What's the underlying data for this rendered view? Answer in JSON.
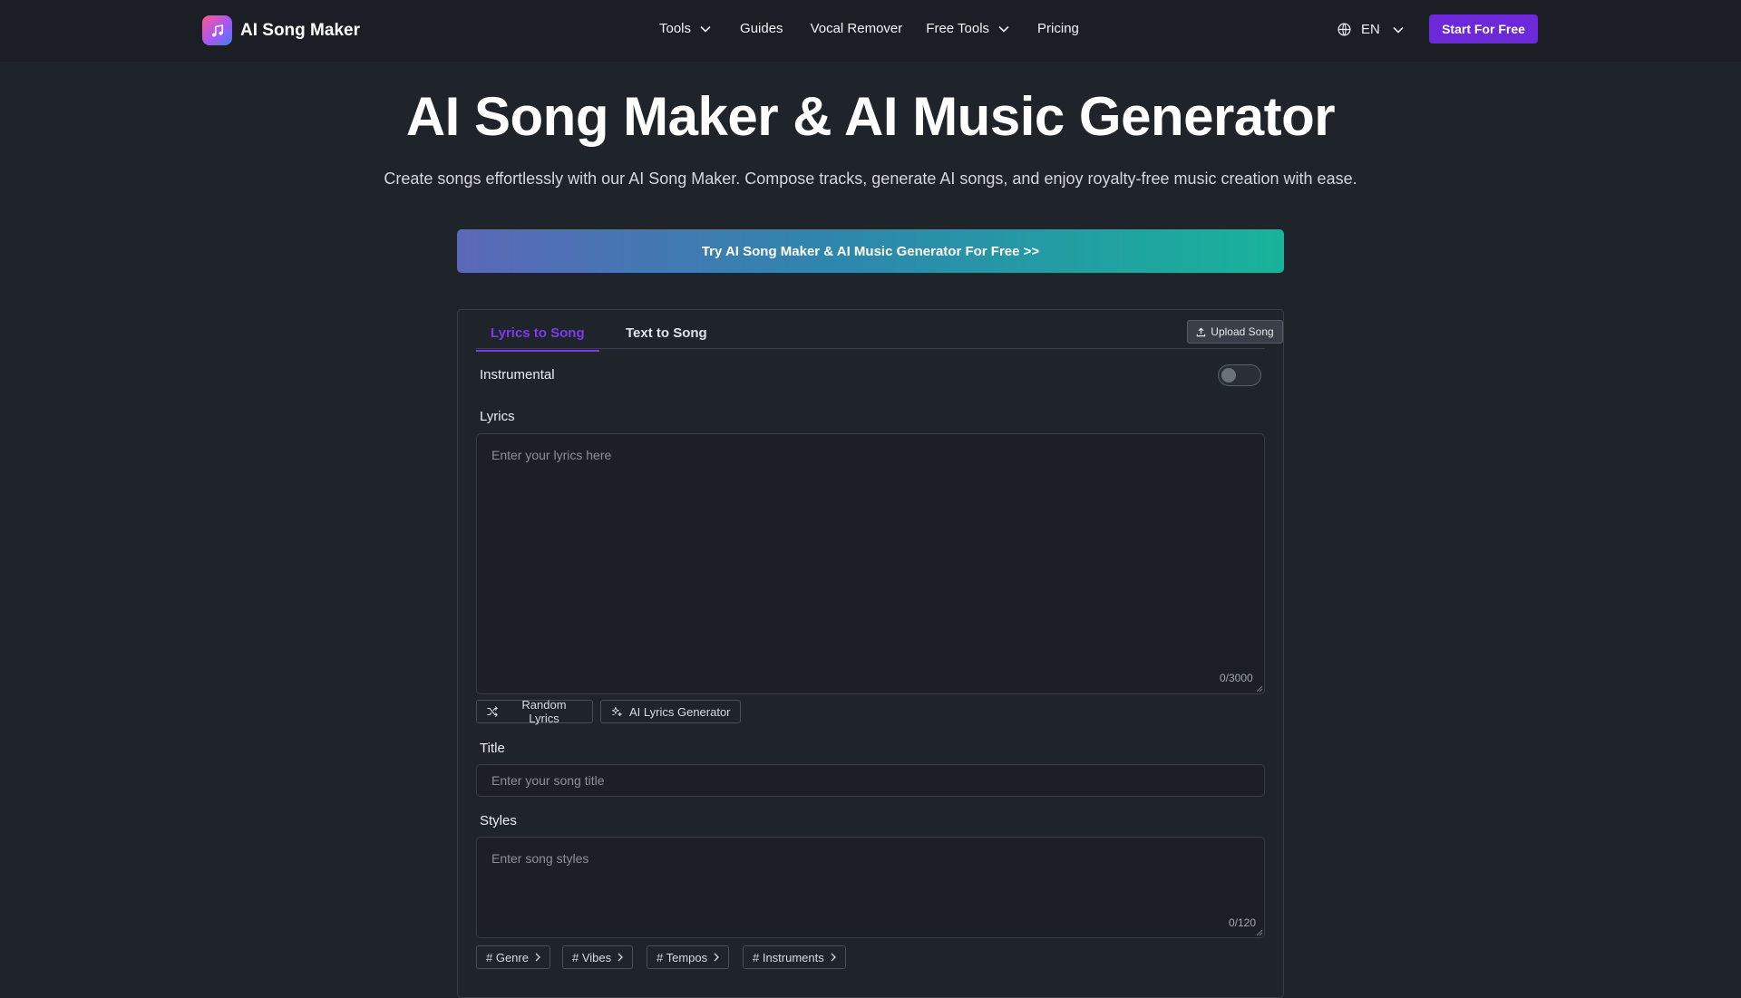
{
  "nav": {
    "brand": "AI Song Maker",
    "items": [
      {
        "label": "Tools",
        "has_dropdown": true
      },
      {
        "label": "Guides",
        "has_dropdown": false
      },
      {
        "label": "Vocal Remover",
        "has_dropdown": false
      },
      {
        "label": "Free Tools",
        "has_dropdown": true
      },
      {
        "label": "Pricing",
        "has_dropdown": false
      }
    ],
    "language": "EN",
    "cta": "Start For Free"
  },
  "hero": {
    "title": "AI Song Maker & AI Music Generator",
    "subtitle": "Create songs effortlessly with our AI Song Maker. Compose tracks, generate AI songs, and enjoy royalty-free music creation with ease.",
    "banner": "Try AI Song Maker & AI Music Generator For Free >>"
  },
  "form": {
    "tabs": [
      {
        "label": "Lyrics to Song",
        "active": true
      },
      {
        "label": "Text to Song",
        "active": false
      }
    ],
    "upload_label": "Upload Song",
    "instrumental_label": "Instrumental",
    "instrumental_on": false,
    "lyrics_label": "Lyrics",
    "lyrics_placeholder": "Enter your lyrics here",
    "lyrics_value": "",
    "lyrics_counter": "0/3000",
    "random_lyrics": "Random Lyrics",
    "ai_lyrics": "AI Lyrics Generator",
    "title_label": "Title",
    "title_placeholder": "Enter your song title",
    "title_value": "",
    "styles_label": "Styles",
    "styles_placeholder": "Enter song styles",
    "styles_value": "",
    "styles_counter": "0/120",
    "style_tags": [
      "# Genre",
      "# Vibes",
      "# Tempos",
      "# Instruments"
    ]
  },
  "colors": {
    "background": "#1f232a",
    "accent": "#6d28d9",
    "tab_active": "#7c3aed",
    "banner_start": "#5b68b8",
    "banner_end": "#18b39a"
  }
}
